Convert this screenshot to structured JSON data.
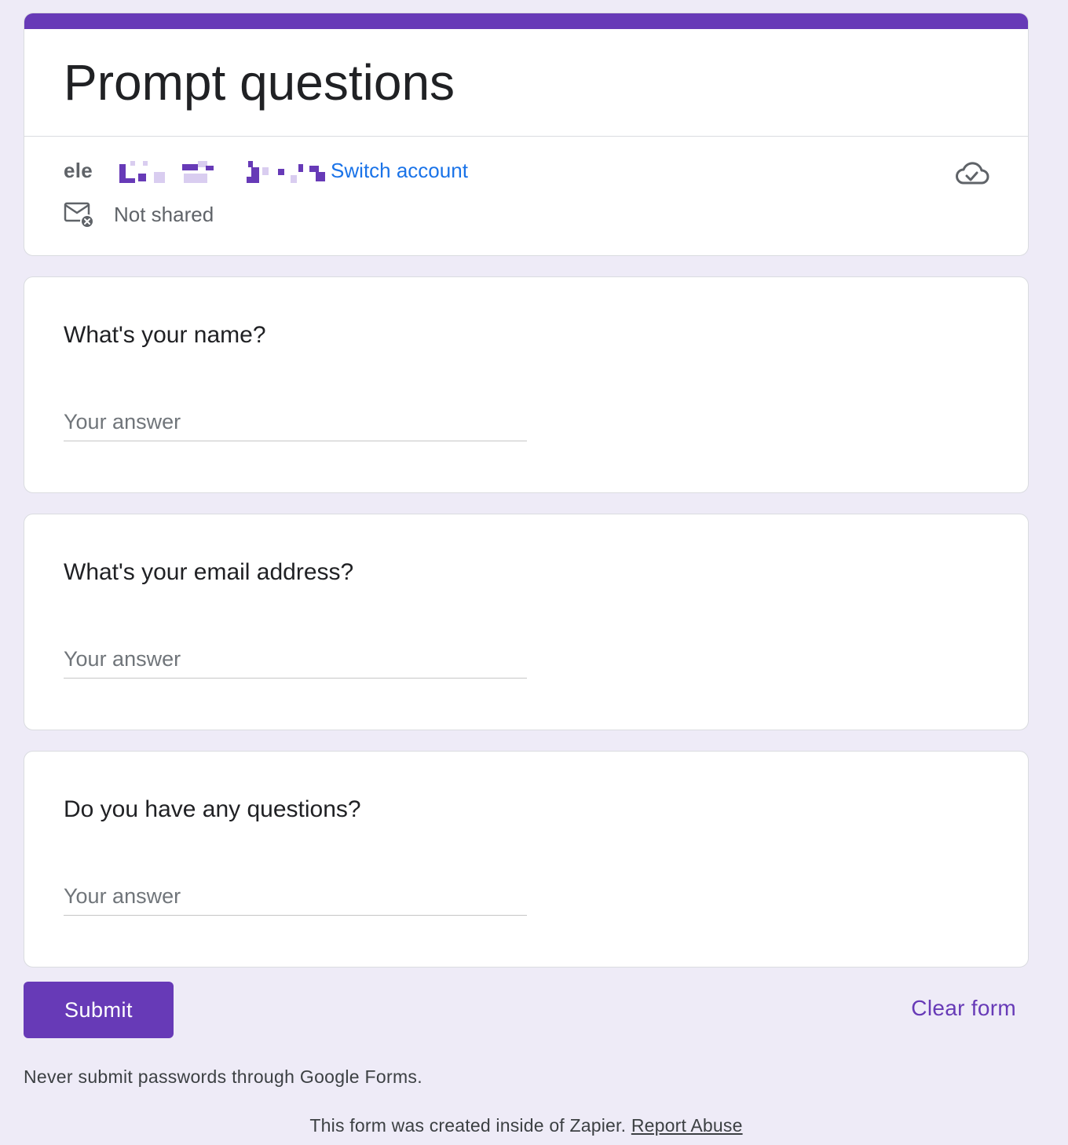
{
  "form": {
    "title": "Prompt questions",
    "accent_color": "#673ab7"
  },
  "account": {
    "email_visible": "ele",
    "switch_label": "Switch account",
    "shared_status": "Not shared"
  },
  "questions": [
    {
      "title": "What's your name?",
      "placeholder": "Your answer",
      "value": ""
    },
    {
      "title": "What's your email address?",
      "placeholder": "Your answer",
      "value": ""
    },
    {
      "title": "Do you have any questions?",
      "placeholder": "Your answer",
      "value": ""
    }
  ],
  "actions": {
    "submit_label": "Submit",
    "clear_label": "Clear form"
  },
  "notices": {
    "password_warning": "Never submit passwords through Google Forms.",
    "footer_text": "This form was created inside of Zapier.",
    "report_label": "Report Abuse"
  },
  "icons": {
    "cloud": "cloud-done-icon",
    "mail": "mail-not-shared-icon"
  }
}
